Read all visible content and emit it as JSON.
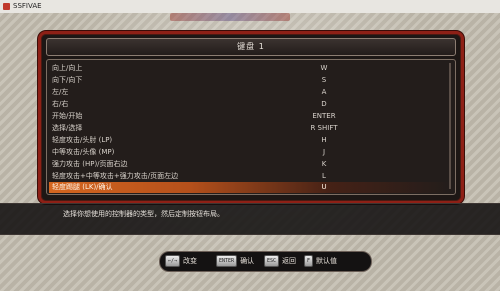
{
  "window": {
    "title": "SSFIVAE"
  },
  "panel": {
    "title": "键盘 1"
  },
  "bindings": [
    {
      "action": "向上/向上",
      "key": "W"
    },
    {
      "action": "向下/向下",
      "key": "S"
    },
    {
      "action": "左/左",
      "key": "A"
    },
    {
      "action": "右/右",
      "key": "D"
    },
    {
      "action": "开始/开始",
      "key": "ENTER"
    },
    {
      "action": "选择/选择",
      "key": "R SHIFT"
    },
    {
      "action": "轻度攻击/头肘 (LP)",
      "key": "H"
    },
    {
      "action": "中等攻击/头像 (MP)",
      "key": "J"
    },
    {
      "action": "强力攻击 (HP)/页面右边",
      "key": "K"
    },
    {
      "action": "轻度攻击+中等攻击+强力攻击/页面左边",
      "key": "L"
    },
    {
      "action": "轻度踢腿 (LK)/确认",
      "key": "U"
    }
  ],
  "selected_index": 10,
  "help": {
    "text": "选择你想使用的控制器的类型，然后定制按钮布局。"
  },
  "controls": [
    {
      "keycap": "←/→",
      "label": "改变"
    },
    {
      "keycap": "ENTER",
      "label": "确认"
    },
    {
      "keycap": "ESC",
      "label": "返回"
    },
    {
      "keycap": "F",
      "label": "默认值"
    }
  ]
}
